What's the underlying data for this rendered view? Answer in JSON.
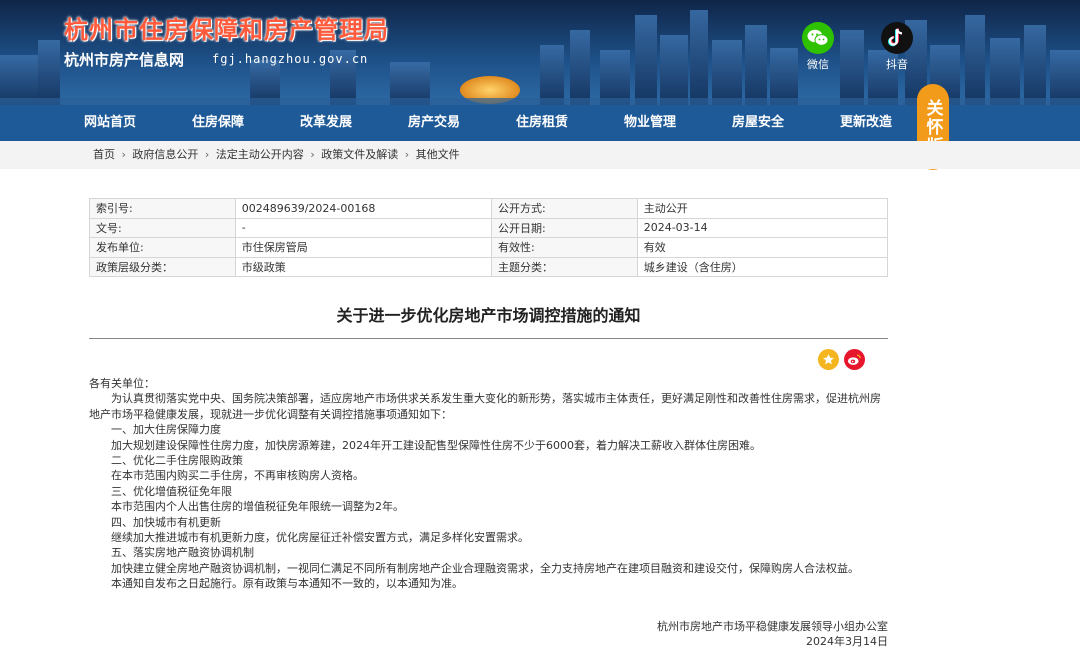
{
  "header": {
    "site_title": "杭州市住房保障和房产管理局",
    "site_subtitle": "杭州市房产信息网",
    "site_domain": "fgj.hangzhou.gov.cn",
    "social": [
      {
        "name": "wechat",
        "label": "微信",
        "icon": "wechat-icon",
        "color": "#2dc100"
      },
      {
        "name": "douyin",
        "label": "抖音",
        "icon": "douyin-icon",
        "color": "#111111"
      }
    ],
    "care_badge": "关怀版"
  },
  "nav": {
    "items": [
      "网站首页",
      "住房保障",
      "改革发展",
      "房产交易",
      "住房租赁",
      "物业管理",
      "房屋安全",
      "更新改造"
    ]
  },
  "breadcrumb": {
    "items": [
      "首页",
      "政府信息公开",
      "法定主动公开内容",
      "政策文件及解读",
      "其他文件"
    ],
    "separator": "›"
  },
  "info": {
    "rows": [
      {
        "k1": "索引号:",
        "v1": "002489639/2024-00168",
        "k2": "公开方式:",
        "v2": "主动公开"
      },
      {
        "k1": "文号:",
        "v1": "-",
        "k2": "公开日期:",
        "v2": "2024-03-14"
      },
      {
        "k1": "发布单位:",
        "v1": "市住保房管局",
        "k2": "有效性:",
        "v2": "有效"
      },
      {
        "k1": "政策层级分类：",
        "v1": "市级政策",
        "k2": "主题分类：",
        "v2": "城乡建设（含住房）"
      }
    ]
  },
  "article": {
    "title": "关于进一步优化房地产市场调控措施的通知",
    "share": [
      {
        "name": "favorite",
        "icon": "star-icon",
        "color": "#f5b51f"
      },
      {
        "name": "weibo",
        "icon": "weibo-icon",
        "color": "#e6162d"
      }
    ],
    "paragraphs": [
      {
        "text": "各有关单位：",
        "indent": false
      },
      {
        "text": "为认真贯彻落实党中央、国务院决策部署，适应房地产市场供求关系发生重大变化的新形势，落实城市主体责任，更好满足刚性和改善性住房需求，促进杭州房地产市场平稳健康发展，现就进一步优化调整有关调控措施事项通知如下：",
        "indent": true
      },
      {
        "text": "一、加大住房保障力度",
        "indent": true
      },
      {
        "text": "加大规划建设保障性住房力度，加快房源筹建，2024年开工建设配售型保障性住房不少于6000套，着力解决工薪收入群体住房困难。",
        "indent": true
      },
      {
        "text": "二、优化二手住房限购政策",
        "indent": true
      },
      {
        "text": "在本市范围内购买二手住房，不再审核购房人资格。",
        "indent": true
      },
      {
        "text": "三、优化增值税征免年限",
        "indent": true
      },
      {
        "text": "本市范围内个人出售住房的增值税征免年限统一调整为2年。",
        "indent": true
      },
      {
        "text": "四、加快城市有机更新",
        "indent": true
      },
      {
        "text": "继续加大推进城市有机更新力度，优化房屋征迁补偿安置方式，满足多样化安置需求。",
        "indent": true
      },
      {
        "text": "五、落实房地产融资协调机制",
        "indent": true
      },
      {
        "text": "加快建立健全房地产融资协调机制，一视同仁满足不同所有制房地产企业合理融资需求，全力支持房地产在建项目融资和建设交付，保障购房人合法权益。",
        "indent": true
      },
      {
        "text": "本通知自发布之日起施行。原有政策与本通知不一致的，以本通知为准。",
        "indent": true
      }
    ],
    "signature_org": "杭州市房地产市场平稳健康发展领导小组办公室",
    "signature_date": "2024年3月14日"
  }
}
